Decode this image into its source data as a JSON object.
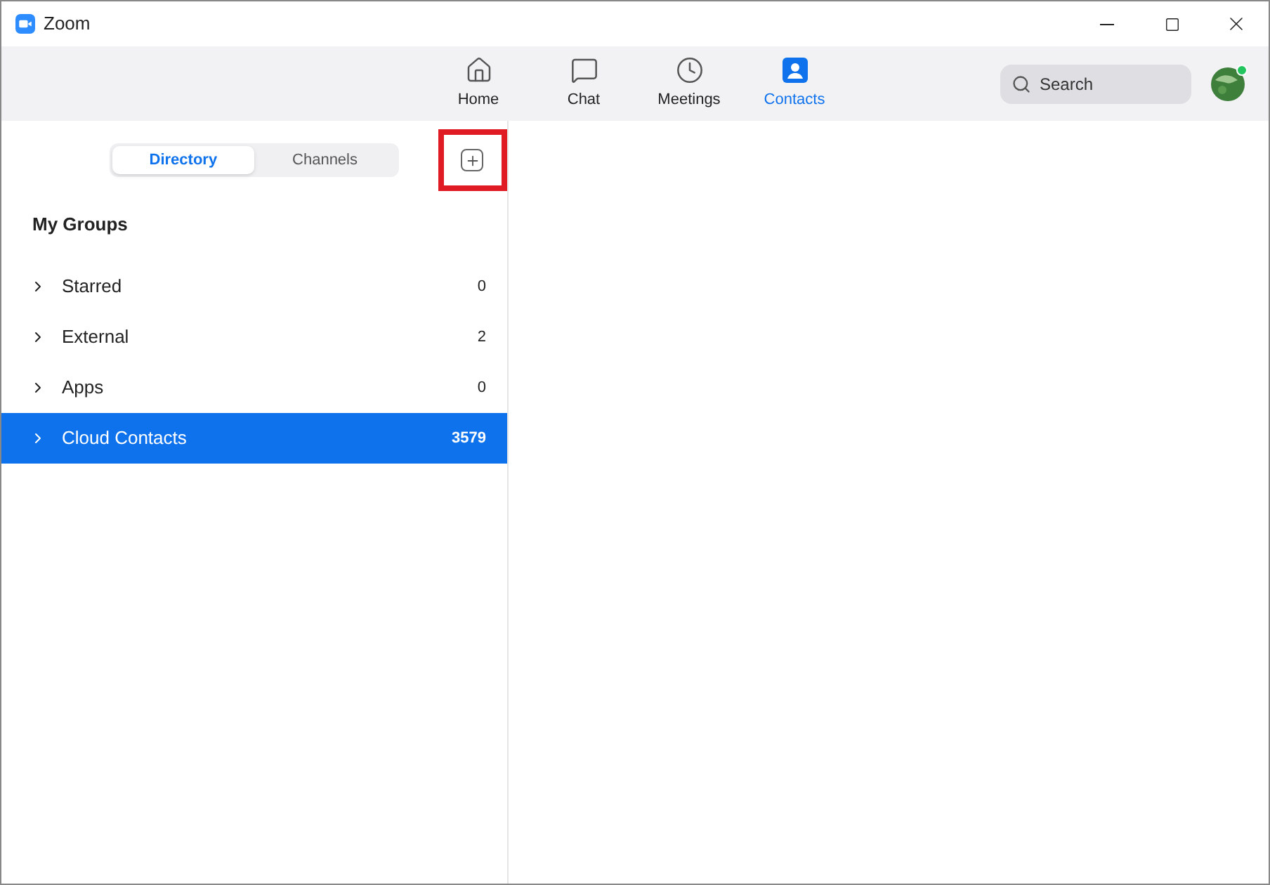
{
  "window": {
    "title": "Zoom"
  },
  "nav_tabs": [
    {
      "label": "Home",
      "kind": "home",
      "selected": false
    },
    {
      "label": "Chat",
      "kind": "chat",
      "selected": false
    },
    {
      "label": "Meetings",
      "kind": "meetings",
      "selected": false
    },
    {
      "label": "Contacts",
      "kind": "contacts",
      "selected": true
    }
  ],
  "search": {
    "placeholder": "Search"
  },
  "profile": {
    "online": true
  },
  "segments": [
    {
      "label": "Directory",
      "selected": true
    },
    {
      "label": "Channels",
      "selected": false
    }
  ],
  "add_button": {
    "highlighted": true
  },
  "groups_heading": "My Groups",
  "groups": [
    {
      "name": "Starred",
      "count": "0",
      "selected": false
    },
    {
      "name": "External",
      "count": "2",
      "selected": false
    },
    {
      "name": "Apps",
      "count": "0",
      "selected": false
    },
    {
      "name": "Cloud Contacts",
      "count": "3579",
      "selected": true
    }
  ]
}
